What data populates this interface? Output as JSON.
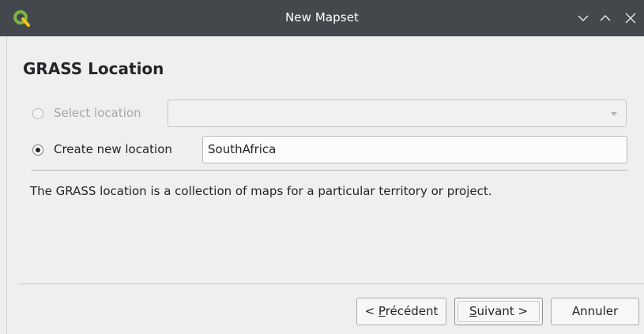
{
  "window": {
    "title": "New Mapset",
    "app_icon": "qgis-logo-icon",
    "controls": [
      "minimize-icon",
      "maximize-icon",
      "close-icon"
    ]
  },
  "page": {
    "title": "GRASS Location",
    "select_location": {
      "label": "Select location",
      "enabled": false,
      "checked": false,
      "combo_value": ""
    },
    "create_location": {
      "label": "Create new location",
      "checked": true,
      "value": "SouthAfrica"
    },
    "description": "The GRASS location is a collection of maps for a particular territory or project."
  },
  "buttons": {
    "previous": {
      "prefix": "< ",
      "mnemonic": "P",
      "rest": "récédent"
    },
    "next": {
      "mnemonic": "S",
      "rest": "uivant >"
    },
    "cancel": {
      "label": "Annuler"
    }
  },
  "colors": {
    "titlebar": "#44474c",
    "qgis_green": "#7bb543",
    "text": "#232629"
  }
}
